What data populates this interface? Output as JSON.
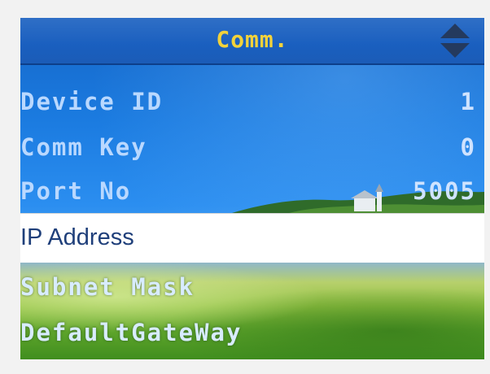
{
  "header": {
    "title": "Comm.",
    "scroll_icon": "up-down-arrows-icon"
  },
  "menu": {
    "items": [
      {
        "label": "Device ID",
        "value": "1"
      },
      {
        "label": "Comm Key",
        "value": "0"
      },
      {
        "label": "Port No",
        "value": "5005"
      },
      {
        "label": "IP Address",
        "value": "",
        "selected": true
      },
      {
        "label": "Subnet Mask",
        "value": ""
      },
      {
        "label": "DefaultGateWay",
        "value": ""
      }
    ]
  },
  "colors": {
    "title_text": "#f2d23b",
    "menu_text": "#b9d8ff",
    "selected_bg": "#ffffff",
    "selected_text": "#1f3f7a"
  }
}
